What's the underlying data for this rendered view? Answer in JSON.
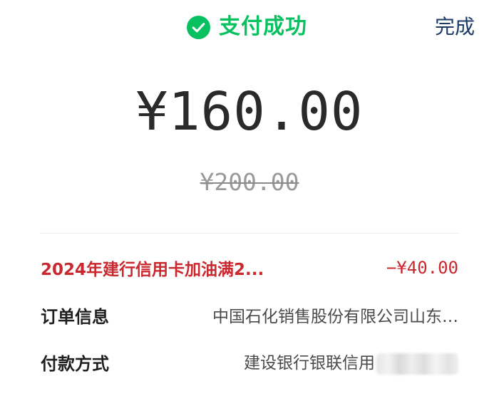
{
  "header": {
    "status_text": "支付成功",
    "status_icon": "check-circle-icon",
    "done_label": "完成"
  },
  "payment": {
    "amount": "¥160.00",
    "original_amount": "¥200.00"
  },
  "discount": {
    "label": "2024年建行信用卡加油满2...",
    "value": "−¥40.00"
  },
  "order_info": {
    "label": "订单信息",
    "value": "中国石化销售股份有限公司山东…"
  },
  "payment_method": {
    "label": "付款方式",
    "value": "建设银行银联信用"
  },
  "colors": {
    "success_green": "#07c160",
    "discount_red": "#c9282f",
    "link_blue": "#1b3a66"
  }
}
